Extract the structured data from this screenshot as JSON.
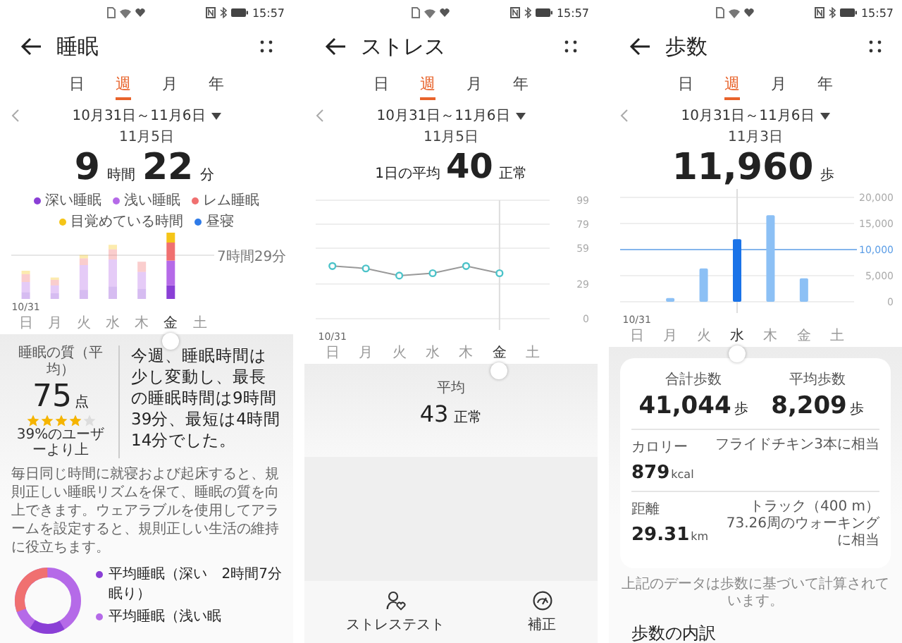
{
  "panels": [
    {
      "kind": "sleep",
      "status_bar": {
        "time": "15:57"
      },
      "title": "睡眠",
      "tabs": [
        {
          "label": "日",
          "selected": false
        },
        {
          "label": "週",
          "selected": true
        },
        {
          "label": "月",
          "selected": false
        },
        {
          "label": "年",
          "selected": false
        }
      ],
      "date_range": "10月31日～11月6日",
      "date": "11月5日",
      "total": {
        "hours": "9",
        "hours_unit": "時間",
        "minutes": "22",
        "minutes_unit": "分"
      },
      "legend": [
        {
          "label": "深い睡眠",
          "color": "#8a3fd6"
        },
        {
          "label": "浅い睡眠",
          "color": "#b56ae8"
        },
        {
          "label": "レム睡眠",
          "color": "#f07070"
        },
        {
          "label": "目覚めている時間",
          "color": "#f5c518"
        },
        {
          "label": "昼寝",
          "color": "#2f7be8"
        }
      ],
      "reference_label": "7時間29分",
      "x_labels": [
        "日",
        "月",
        "火",
        "水",
        "木",
        "金",
        "土"
      ],
      "day_selected": [
        false,
        false,
        false,
        false,
        false,
        true,
        false
      ],
      "first_day_date": "10/31",
      "quality": {
        "label": "睡眠の質（平均）",
        "score": "75",
        "unit": "点",
        "stars": 4,
        "ranking": "39%のユーザーより上"
      },
      "summary": "今週、睡眠時間は少し変動し、最長の睡眠時間は9時間39分、最短は4時間14分でした。",
      "tip": "毎日同じ時間に就寝および起床すると、規則正しい睡眠リズムを保て、睡眠の質を向上できます。ウェアラブルを使用してアラームを設定すると、規則正しい生活の維持に役立ちます。",
      "breakdown": [
        {
          "label": "平均睡眠（深い眠り）",
          "value": "2時間7分",
          "color": "#8a3fd6"
        },
        {
          "label": "平均睡眠（浅い眠",
          "color": "#b56ae8"
        }
      ]
    },
    {
      "kind": "stress",
      "status_bar": {
        "time": "15:57"
      },
      "title": "ストレス",
      "tabs": [
        {
          "label": "日",
          "selected": false
        },
        {
          "label": "週",
          "selected": true
        },
        {
          "label": "月",
          "selected": false
        },
        {
          "label": "年",
          "selected": false
        }
      ],
      "date_range": "10月31日～11月6日",
      "date": "11月5日",
      "daily_average": {
        "label": "1日の平均",
        "value": "40",
        "status": "正常"
      },
      "chart_data": {
        "type": "line",
        "categories": [
          "日",
          "月",
          "火",
          "水",
          "木",
          "金",
          "土"
        ],
        "series": [
          {
            "color": "#4cc3c9",
            "marker": "o",
            "values": [
              44,
              42,
              36,
              38,
              44,
              38,
              null
            ]
          }
        ],
        "ylim": [
          0,
          99
        ],
        "yticks": [
          0,
          29,
          59,
          79,
          99
        ],
        "grid": true,
        "ref_lines": [
          {
            "axis": "x",
            "value": "金"
          }
        ]
      },
      "day_selected": [
        false,
        false,
        false,
        false,
        false,
        true,
        false
      ],
      "first_day_date": "10/31",
      "average": {
        "label": "平均",
        "value": "43",
        "status": "正常"
      },
      "actions": [
        {
          "kind": "test",
          "label": "ストレステスト"
        },
        {
          "kind": "calibrate",
          "label": "補正"
        }
      ]
    },
    {
      "kind": "steps",
      "status_bar": {
        "time": "15:57"
      },
      "title": "歩数",
      "tabs": [
        {
          "label": "日",
          "selected": false
        },
        {
          "label": "週",
          "selected": true
        },
        {
          "label": "月",
          "selected": false
        },
        {
          "label": "年",
          "selected": false
        }
      ],
      "date_range": "10月31日～11月6日",
      "date": "11月3日",
      "total": {
        "value": "11,960",
        "unit": "歩"
      },
      "chart_data": {
        "type": "bar",
        "categories": [
          "日",
          "月",
          "火",
          "水",
          "木",
          "金",
          "土"
        ],
        "stacked": true,
        "series": [
          {
            "color": "#8cc0f5",
            "values": [
              0,
              700,
              6400,
              null,
              16600,
              4500,
              0
            ]
          },
          {
            "color": "#1a73e8",
            "values": [
              null,
              null,
              null,
              12000,
              null,
              null,
              null
            ]
          }
        ],
        "ylim": [
          0,
          20000
        ],
        "yticks": [
          {
            "value": 0,
            "label": "0"
          },
          {
            "value": 5000,
            "label": "5,000"
          },
          {
            "value": 10000,
            "label": "10,000"
          },
          {
            "value": 15000,
            "label": "15,000"
          },
          {
            "value": 20000,
            "label": "20,000"
          }
        ],
        "grid": true,
        "ref_lines": [
          {
            "axis": "y",
            "value": 10000
          },
          {
            "axis": "x",
            "value": "水"
          }
        ]
      },
      "day_selected": [
        false,
        false,
        false,
        true,
        false,
        false,
        false
      ],
      "first_day_date": "10/31",
      "stats": [
        {
          "label": "合計歩数",
          "value": "41,044",
          "unit": "歩"
        },
        {
          "label": "平均歩数",
          "value": "8,209",
          "unit": "歩"
        }
      ],
      "metrics": [
        {
          "label": "カロリー",
          "value": "879",
          "unit": "kcal",
          "equivalent": "フライドチキン3本に相当"
        },
        {
          "label": "距離",
          "value": "29.31",
          "unit": "km",
          "equivalent": "トラック（400 m）73.26周のウォーキングに相当"
        }
      ],
      "note": "上記のデータは歩数に基づいて計算されています。",
      "section_title": "歩数の内訳"
    }
  ]
}
